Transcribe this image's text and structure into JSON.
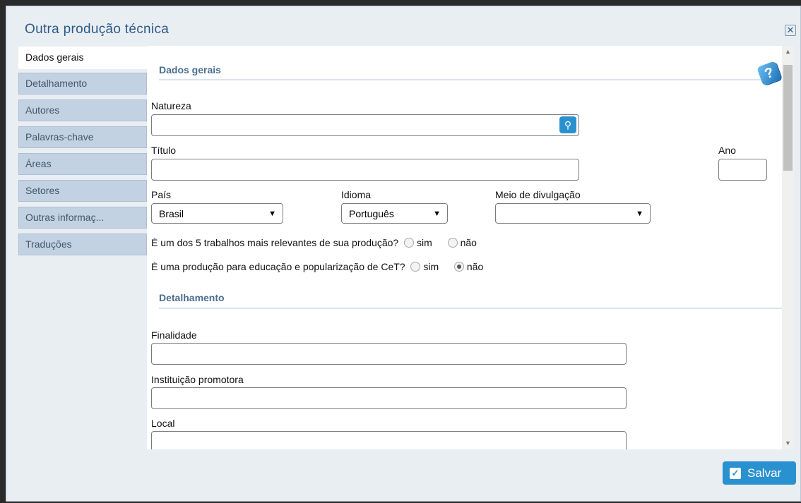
{
  "dialog": {
    "title": "Outra produção técnica",
    "close_glyph": "✕"
  },
  "tabs": [
    {
      "label": "Dados gerais",
      "active": true
    },
    {
      "label": "Detalhamento",
      "active": false
    },
    {
      "label": "Autores",
      "active": false
    },
    {
      "label": "Palavras-chave",
      "active": false
    },
    {
      "label": "Áreas",
      "active": false
    },
    {
      "label": "Setores",
      "active": false
    },
    {
      "label": "Outras informaç...",
      "active": false
    },
    {
      "label": "Traduções",
      "active": false
    }
  ],
  "dados_gerais": {
    "section_title": "Dados gerais",
    "natureza_label": "Natureza",
    "natureza_value": "",
    "titulo_label": "Título",
    "titulo_value": "",
    "ano_label": "Ano",
    "ano_value": "",
    "pais_label": "País",
    "pais_value": "Brasil",
    "idioma_label": "Idioma",
    "idioma_value": "Português",
    "meio_label": "Meio de divulgação",
    "meio_value": "",
    "q1_text": "É um dos 5 trabalhos mais relevantes de sua produção?",
    "q1_sim": "sim",
    "q1_nao": "não",
    "q1_selected": "none",
    "q2_text": "É uma produção para educação e popularização de CeT?",
    "q2_sim": "sim",
    "q2_nao": "não",
    "q2_selected": "não"
  },
  "detalhamento": {
    "section_title": "Detalhamento",
    "finalidade_label": "Finalidade",
    "finalidade_value": "",
    "instituicao_label": "Instituição promotora",
    "instituicao_value": "",
    "local_label": "Local",
    "local_value": ""
  },
  "footer": {
    "save_label": "Salvar"
  },
  "icons": {
    "help": "help-book-icon",
    "search": "search-icon",
    "save": "checkbox-icon",
    "close": "close-icon"
  },
  "colors": {
    "accent": "#2a91d0",
    "title": "#2d5b86",
    "tab_bg": "#c2d2e3"
  }
}
